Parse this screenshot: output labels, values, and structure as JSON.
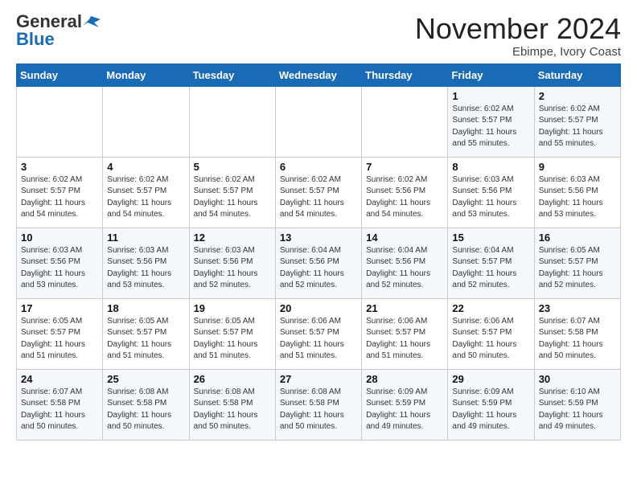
{
  "header": {
    "logo_general": "General",
    "logo_blue": "Blue",
    "month_title": "November 2024",
    "location": "Ebimpe, Ivory Coast"
  },
  "weekdays": [
    "Sunday",
    "Monday",
    "Tuesday",
    "Wednesday",
    "Thursday",
    "Friday",
    "Saturday"
  ],
  "weeks": [
    [
      {
        "num": "",
        "info": ""
      },
      {
        "num": "",
        "info": ""
      },
      {
        "num": "",
        "info": ""
      },
      {
        "num": "",
        "info": ""
      },
      {
        "num": "",
        "info": ""
      },
      {
        "num": "1",
        "info": "Sunrise: 6:02 AM\nSunset: 5:57 PM\nDaylight: 11 hours\nand 55 minutes."
      },
      {
        "num": "2",
        "info": "Sunrise: 6:02 AM\nSunset: 5:57 PM\nDaylight: 11 hours\nand 55 minutes."
      }
    ],
    [
      {
        "num": "3",
        "info": "Sunrise: 6:02 AM\nSunset: 5:57 PM\nDaylight: 11 hours\nand 54 minutes."
      },
      {
        "num": "4",
        "info": "Sunrise: 6:02 AM\nSunset: 5:57 PM\nDaylight: 11 hours\nand 54 minutes."
      },
      {
        "num": "5",
        "info": "Sunrise: 6:02 AM\nSunset: 5:57 PM\nDaylight: 11 hours\nand 54 minutes."
      },
      {
        "num": "6",
        "info": "Sunrise: 6:02 AM\nSunset: 5:57 PM\nDaylight: 11 hours\nand 54 minutes."
      },
      {
        "num": "7",
        "info": "Sunrise: 6:02 AM\nSunset: 5:56 PM\nDaylight: 11 hours\nand 54 minutes."
      },
      {
        "num": "8",
        "info": "Sunrise: 6:03 AM\nSunset: 5:56 PM\nDaylight: 11 hours\nand 53 minutes."
      },
      {
        "num": "9",
        "info": "Sunrise: 6:03 AM\nSunset: 5:56 PM\nDaylight: 11 hours\nand 53 minutes."
      }
    ],
    [
      {
        "num": "10",
        "info": "Sunrise: 6:03 AM\nSunset: 5:56 PM\nDaylight: 11 hours\nand 53 minutes."
      },
      {
        "num": "11",
        "info": "Sunrise: 6:03 AM\nSunset: 5:56 PM\nDaylight: 11 hours\nand 53 minutes."
      },
      {
        "num": "12",
        "info": "Sunrise: 6:03 AM\nSunset: 5:56 PM\nDaylight: 11 hours\nand 52 minutes."
      },
      {
        "num": "13",
        "info": "Sunrise: 6:04 AM\nSunset: 5:56 PM\nDaylight: 11 hours\nand 52 minutes."
      },
      {
        "num": "14",
        "info": "Sunrise: 6:04 AM\nSunset: 5:56 PM\nDaylight: 11 hours\nand 52 minutes."
      },
      {
        "num": "15",
        "info": "Sunrise: 6:04 AM\nSunset: 5:57 PM\nDaylight: 11 hours\nand 52 minutes."
      },
      {
        "num": "16",
        "info": "Sunrise: 6:05 AM\nSunset: 5:57 PM\nDaylight: 11 hours\nand 52 minutes."
      }
    ],
    [
      {
        "num": "17",
        "info": "Sunrise: 6:05 AM\nSunset: 5:57 PM\nDaylight: 11 hours\nand 51 minutes."
      },
      {
        "num": "18",
        "info": "Sunrise: 6:05 AM\nSunset: 5:57 PM\nDaylight: 11 hours\nand 51 minutes."
      },
      {
        "num": "19",
        "info": "Sunrise: 6:05 AM\nSunset: 5:57 PM\nDaylight: 11 hours\nand 51 minutes."
      },
      {
        "num": "20",
        "info": "Sunrise: 6:06 AM\nSunset: 5:57 PM\nDaylight: 11 hours\nand 51 minutes."
      },
      {
        "num": "21",
        "info": "Sunrise: 6:06 AM\nSunset: 5:57 PM\nDaylight: 11 hours\nand 51 minutes."
      },
      {
        "num": "22",
        "info": "Sunrise: 6:06 AM\nSunset: 5:57 PM\nDaylight: 11 hours\nand 50 minutes."
      },
      {
        "num": "23",
        "info": "Sunrise: 6:07 AM\nSunset: 5:58 PM\nDaylight: 11 hours\nand 50 minutes."
      }
    ],
    [
      {
        "num": "24",
        "info": "Sunrise: 6:07 AM\nSunset: 5:58 PM\nDaylight: 11 hours\nand 50 minutes."
      },
      {
        "num": "25",
        "info": "Sunrise: 6:08 AM\nSunset: 5:58 PM\nDaylight: 11 hours\nand 50 minutes."
      },
      {
        "num": "26",
        "info": "Sunrise: 6:08 AM\nSunset: 5:58 PM\nDaylight: 11 hours\nand 50 minutes."
      },
      {
        "num": "27",
        "info": "Sunrise: 6:08 AM\nSunset: 5:58 PM\nDaylight: 11 hours\nand 50 minutes."
      },
      {
        "num": "28",
        "info": "Sunrise: 6:09 AM\nSunset: 5:59 PM\nDaylight: 11 hours\nand 49 minutes."
      },
      {
        "num": "29",
        "info": "Sunrise: 6:09 AM\nSunset: 5:59 PM\nDaylight: 11 hours\nand 49 minutes."
      },
      {
        "num": "30",
        "info": "Sunrise: 6:10 AM\nSunset: 5:59 PM\nDaylight: 11 hours\nand 49 minutes."
      }
    ]
  ]
}
